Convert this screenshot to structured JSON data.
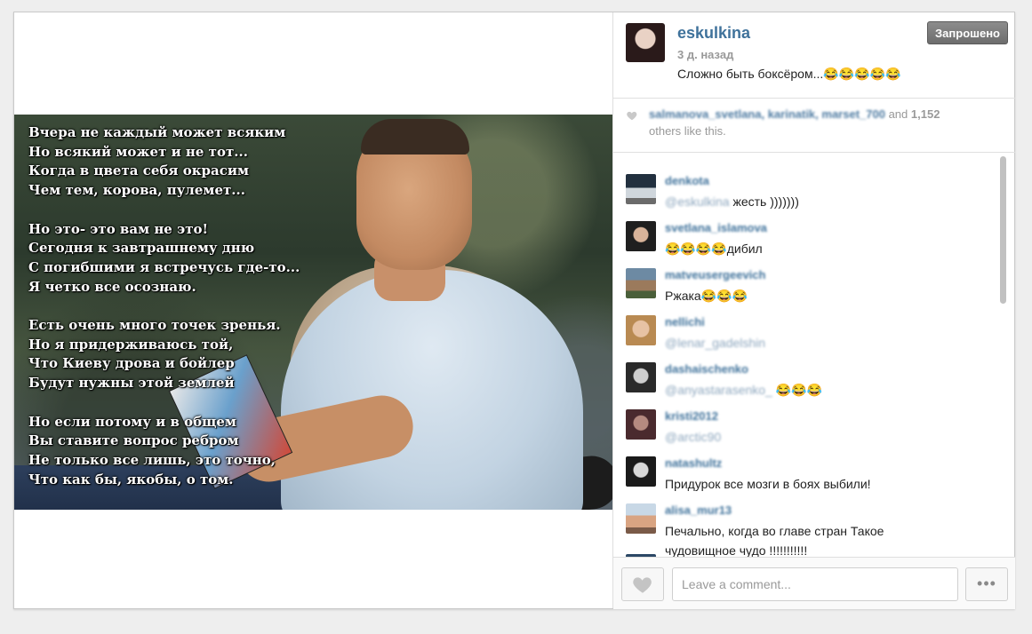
{
  "post": {
    "username": "eskulkina",
    "time_ago": "3 д. назад",
    "caption": "Сложно быть боксёром...😂😂😂😂😂",
    "follow_button": "Запрошено"
  },
  "image_text": {
    "stanzas": [
      [
        "Вчера не каждый может всяким",
        "Но всякий может и не тот...",
        "Когда в цвета себя окрасим",
        "Чем тем, корова, пулемет..."
      ],
      [
        "Но это- это вам не это!",
        "Сегодня к завтрашнему дню",
        "С погибшими я встречусь где-то...",
        "Я четко все осознаю."
      ],
      [
        "Есть очень много точек зренья.",
        "Но я придерживаюсь той,",
        "Что Киеву дрова и бойлер",
        "Будут нужны этой землей"
      ],
      [
        "Но если потому и в общем",
        "Вы ставите вопрос ребром",
        "Не только все лишь, это точно,",
        "Что как бы, якобы, о том."
      ]
    ]
  },
  "likes": {
    "names": "salmanova_svetlana, karinatik, marset_700",
    "and_text": "and",
    "count": "1,152",
    "others_text": "others like this."
  },
  "comments": [
    {
      "user": "denkota",
      "mention": "@eskulkina",
      "text": "жесть )))))))"
    },
    {
      "user": "svetlana_islamova",
      "mention": "",
      "text": "😂😂😂😂дибил"
    },
    {
      "user": "matveusergeevich",
      "mention": "",
      "text": "Ржака😂😂😂"
    },
    {
      "user": "nellichi",
      "mention": "@lenar_gadelshin",
      "text": ""
    },
    {
      "user": "dashaischenko",
      "mention": "@anyastarasenko_",
      "text": " 😂😂😂"
    },
    {
      "user": "kristi2012",
      "mention": "@arctic90",
      "text": ""
    },
    {
      "user": "natashultz",
      "mention": "",
      "text": "Придурок все мозги в боях выбили!"
    },
    {
      "user": "alisa_mur13",
      "mention": "",
      "text": "Печально, когда во главе стран Такое чудовищное чудо !!!!!!!!!!!"
    }
  ],
  "footer": {
    "comment_placeholder": "Leave a comment...",
    "more_label": "•••"
  },
  "colors": {
    "username": "#3f729b",
    "button": "#777777",
    "text": "#222222",
    "muted": "#999999"
  }
}
